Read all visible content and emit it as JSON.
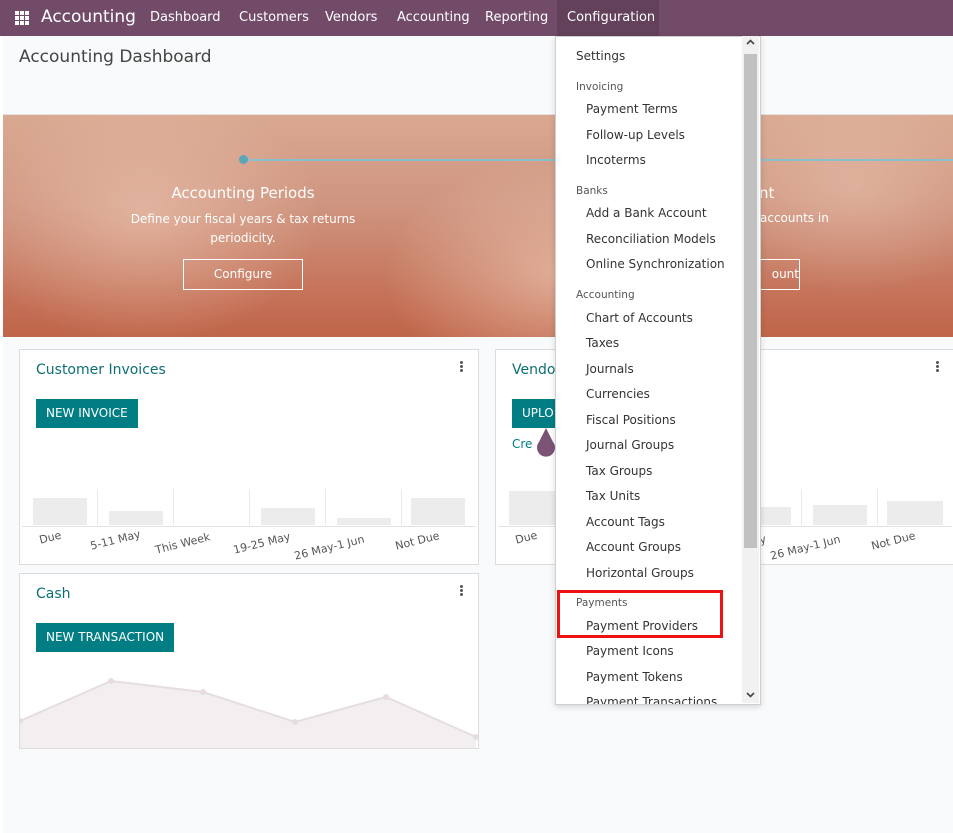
{
  "app": {
    "brand": "Accounting",
    "menu": [
      "Dashboard",
      "Customers",
      "Vendors",
      "Accounting",
      "Reporting",
      "Configuration"
    ],
    "active_menu": "Configuration",
    "accent_color": "#714b67",
    "primary_color": "#017e84"
  },
  "page": {
    "title": "Accounting Dashboard"
  },
  "banner": {
    "step1": {
      "title": "Accounting Periods",
      "description_line1": "Define your fiscal years & tax returns",
      "description_line2": "periodicity.",
      "button": "Configure"
    },
    "step2": {
      "title_fragment": "nt",
      "description_fragment": "accounts in",
      "button_fragment": "ount"
    }
  },
  "cards": {
    "customer_invoices": {
      "title": "Customer Invoices",
      "button": "NEW INVOICE",
      "chart_labels": [
        "Due",
        "5-11 May",
        "This Week",
        "19-25 May",
        "26 May-1 Jun",
        "Not Due"
      ]
    },
    "vendor_bills": {
      "title_fragment": "Vendo",
      "button_fragment": "UPLO",
      "link_fragment": "Cre",
      "chart_labels": [
        "Due",
        "y",
        "26 May-1 Jun",
        "Not Due"
      ]
    },
    "cash": {
      "title": "Cash",
      "button": "NEW TRANSACTION"
    }
  },
  "dropdown": {
    "settings": "Settings",
    "sections": [
      {
        "header": "Invoicing",
        "items": [
          "Payment Terms",
          "Follow-up Levels",
          "Incoterms"
        ]
      },
      {
        "header": "Banks",
        "items": [
          "Add a Bank Account",
          "Reconciliation Models",
          "Online Synchronization"
        ]
      },
      {
        "header": "Accounting",
        "items": [
          "Chart of Accounts",
          "Taxes",
          "Journals",
          "Currencies",
          "Fiscal Positions",
          "Journal Groups",
          "Tax Groups",
          "Tax Units",
          "Account Tags",
          "Account Groups",
          "Horizontal Groups"
        ]
      },
      {
        "header": "Payments",
        "items": [
          "Payment Providers",
          "Payment Icons",
          "Payment Tokens",
          "Payment Transactions"
        ]
      }
    ],
    "highlighted_item": "Payment Providers"
  },
  "icons": {
    "apps": "apps-grid-icon",
    "kebab": "kebab-menu-icon",
    "scroll_up": "chevron-up-icon",
    "scroll_down": "chevron-down-icon"
  }
}
